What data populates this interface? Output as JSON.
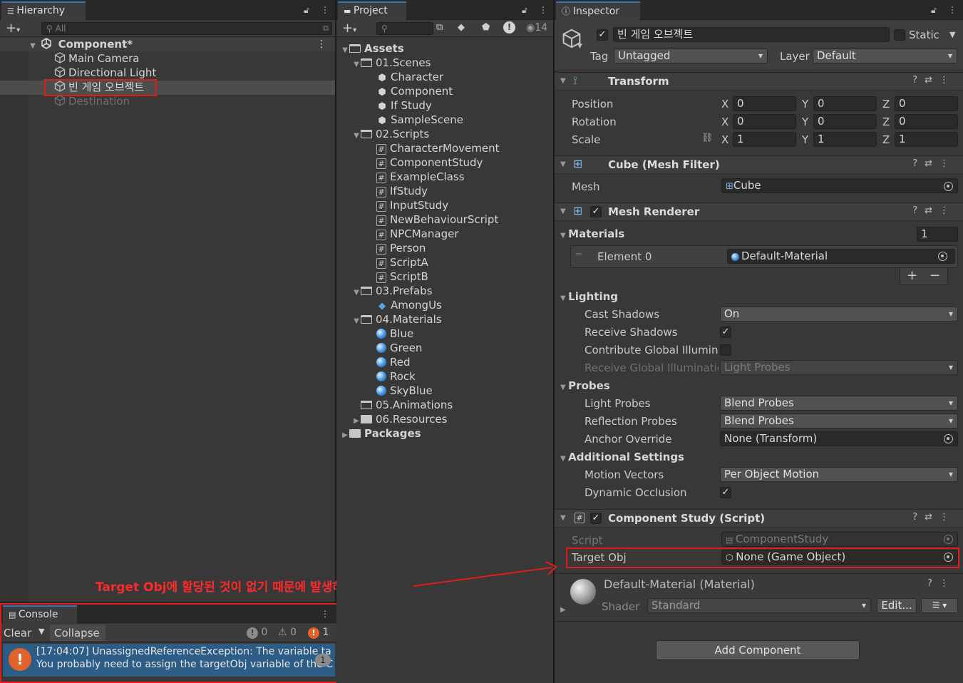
{
  "hierarchy": {
    "tab": "Hierarchy",
    "search_placeholder": "All",
    "scene": "Component*",
    "items": [
      "Main Camera",
      "Directional Light",
      "빈 게임 오브젝트",
      "Destination"
    ]
  },
  "project": {
    "tab": "Project",
    "hidden_count": "14",
    "assets": "Assets",
    "f1": "01.Scenes",
    "scenes": [
      "Character",
      "Component",
      "If Study",
      "SampleScene"
    ],
    "f2": "02.Scripts",
    "scripts": [
      "CharacterMovement",
      "ComponentStudy",
      "ExampleClass",
      "IfStudy",
      "InputStudy",
      "NewBehaviourScript",
      "NPCManager",
      "Person",
      "ScriptA",
      "ScriptB"
    ],
    "f3": "03.Prefabs",
    "prefabs": [
      "AmongUs"
    ],
    "f4": "04.Materials",
    "materials": [
      "Blue",
      "Green",
      "Red",
      "Rock",
      "SkyBlue"
    ],
    "f5": "05.Animations",
    "f6": "06.Resources",
    "packages": "Packages"
  },
  "inspector": {
    "tab": "Inspector",
    "object_name": "빈 게임 오브젝트",
    "static_label": "Static",
    "tag_label": "Tag",
    "tag_value": "Untagged",
    "layer_label": "Layer",
    "layer_value": "Default",
    "transform": {
      "title": "Transform",
      "position": "Position",
      "rotation": "Rotation",
      "scale": "Scale",
      "x": "X",
      "y": "Y",
      "z": "Z",
      "pos": [
        "0",
        "0",
        "0"
      ],
      "rot": [
        "0",
        "0",
        "0"
      ],
      "scl": [
        "1",
        "1",
        "1"
      ]
    },
    "mesh_filter": {
      "title": "Cube (Mesh Filter)",
      "mesh_label": "Mesh",
      "mesh_value": "Cube"
    },
    "mesh_renderer": {
      "title": "Mesh Renderer",
      "materials": "Materials",
      "materials_count": "1",
      "element0": "Element 0",
      "element0_value": "Default-Material",
      "lighting": "Lighting",
      "cast_shadows": "Cast Shadows",
      "cast_shadows_value": "On",
      "receive_shadows": "Receive Shadows",
      "contribute_gi": "Contribute Global Illuminat",
      "receive_gi": "Receive Global Illuminatio",
      "receive_gi_value": "Light Probes",
      "probes": "Probes",
      "light_probes": "Light Probes",
      "light_probes_value": "Blend Probes",
      "reflection_probes": "Reflection Probes",
      "reflection_probes_value": "Blend Probes",
      "anchor_override": "Anchor Override",
      "anchor_override_value": "None (Transform)",
      "additional": "Additional Settings",
      "motion_vectors": "Motion Vectors",
      "motion_vectors_value": "Per Object Motion",
      "dynamic_occlusion": "Dynamic Occlusion"
    },
    "component_study": {
      "title": "Component Study (Script)",
      "script_label": "Script",
      "script_value": "ComponentStudy",
      "target_label": "Target Obj",
      "target_value": "None (Game Object)"
    },
    "material": {
      "title": "Default-Material (Material)",
      "shader_label": "Shader",
      "shader_value": "Standard",
      "edit": "Edit..."
    },
    "add_component": "Add Component"
  },
  "annotation": "Target Obj에 할당된 것이 없기 때문에 발생하는 에러",
  "console": {
    "tab": "Console",
    "clear": "Clear",
    "collapse": "Collapse",
    "info_count": "0",
    "warn_count": "0",
    "error_count": "1",
    "line1": "[17:04:07] UnassignedReferenceException: The variable ta",
    "line2": "You probably need to assign the targetObj variable of the C",
    "repeat": "1"
  },
  "colors": {
    "selection": "#4d4d4d",
    "accent": "#3a72b0",
    "highlight": "#e01b1b",
    "error": "#e0632b"
  }
}
